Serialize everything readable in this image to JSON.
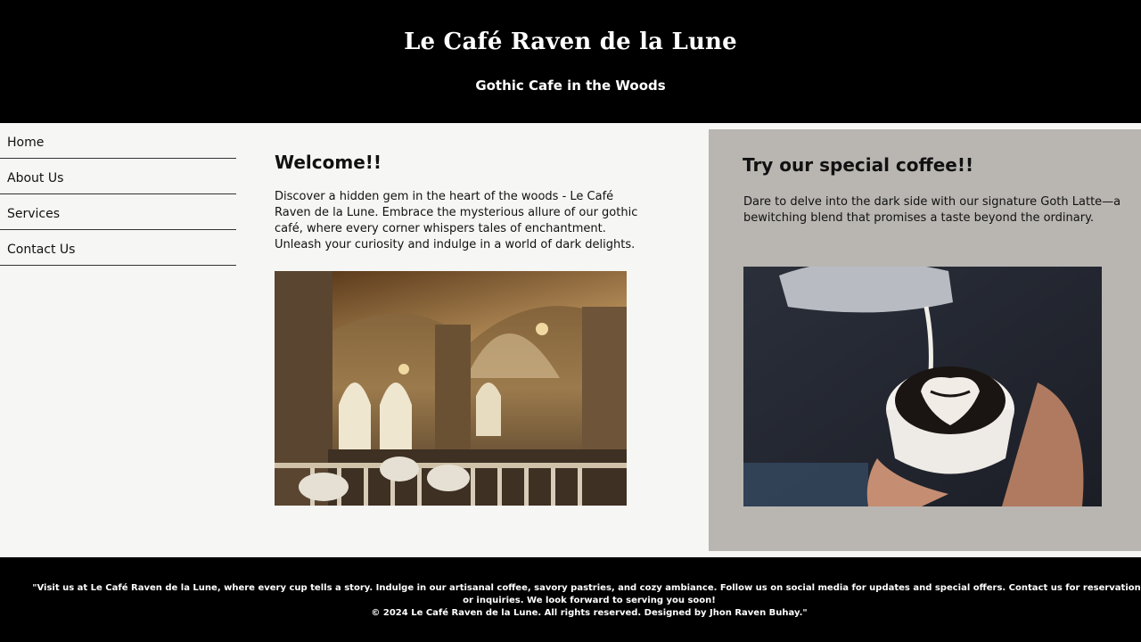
{
  "header": {
    "title": "Le Café Raven de la Lune",
    "tagline": "Gothic Cafe in the Woods"
  },
  "nav": {
    "items": [
      {
        "label": "Home"
      },
      {
        "label": "About Us"
      },
      {
        "label": "Services"
      },
      {
        "label": "Contact Us"
      }
    ]
  },
  "welcome": {
    "heading": "Welcome!!",
    "body": "Discover a hidden gem in the heart of the woods - Le Café Raven de la Lune. Embrace the mysterious allure of our gothic café, where every corner whispers tales of enchantment. Unleash your curiosity and indulge in a world of dark delights."
  },
  "special": {
    "heading": "Try our special coffee!!",
    "body": "Dare to delve into the dark side with our signature Goth Latte—a bewitching blend that promises a taste beyond the ordinary."
  },
  "footer": {
    "text": "\"Visit us at Le Café Raven de la Lune, where every cup tells a story. Indulge in our artisanal coffee, savory pastries, and cozy ambiance. Follow us on social media for updates and special offers. Contact us for reservations or inquiries. We look forward to serving you soon!",
    "copyright": "© 2024 Le Café Raven de la Lune. All rights reserved. Designed by Jhon Raven Buhay.\""
  },
  "colors": {
    "header_bg": "#000000",
    "page_bg": "#f6f6f4",
    "special_bg": "#b9b6b2"
  }
}
